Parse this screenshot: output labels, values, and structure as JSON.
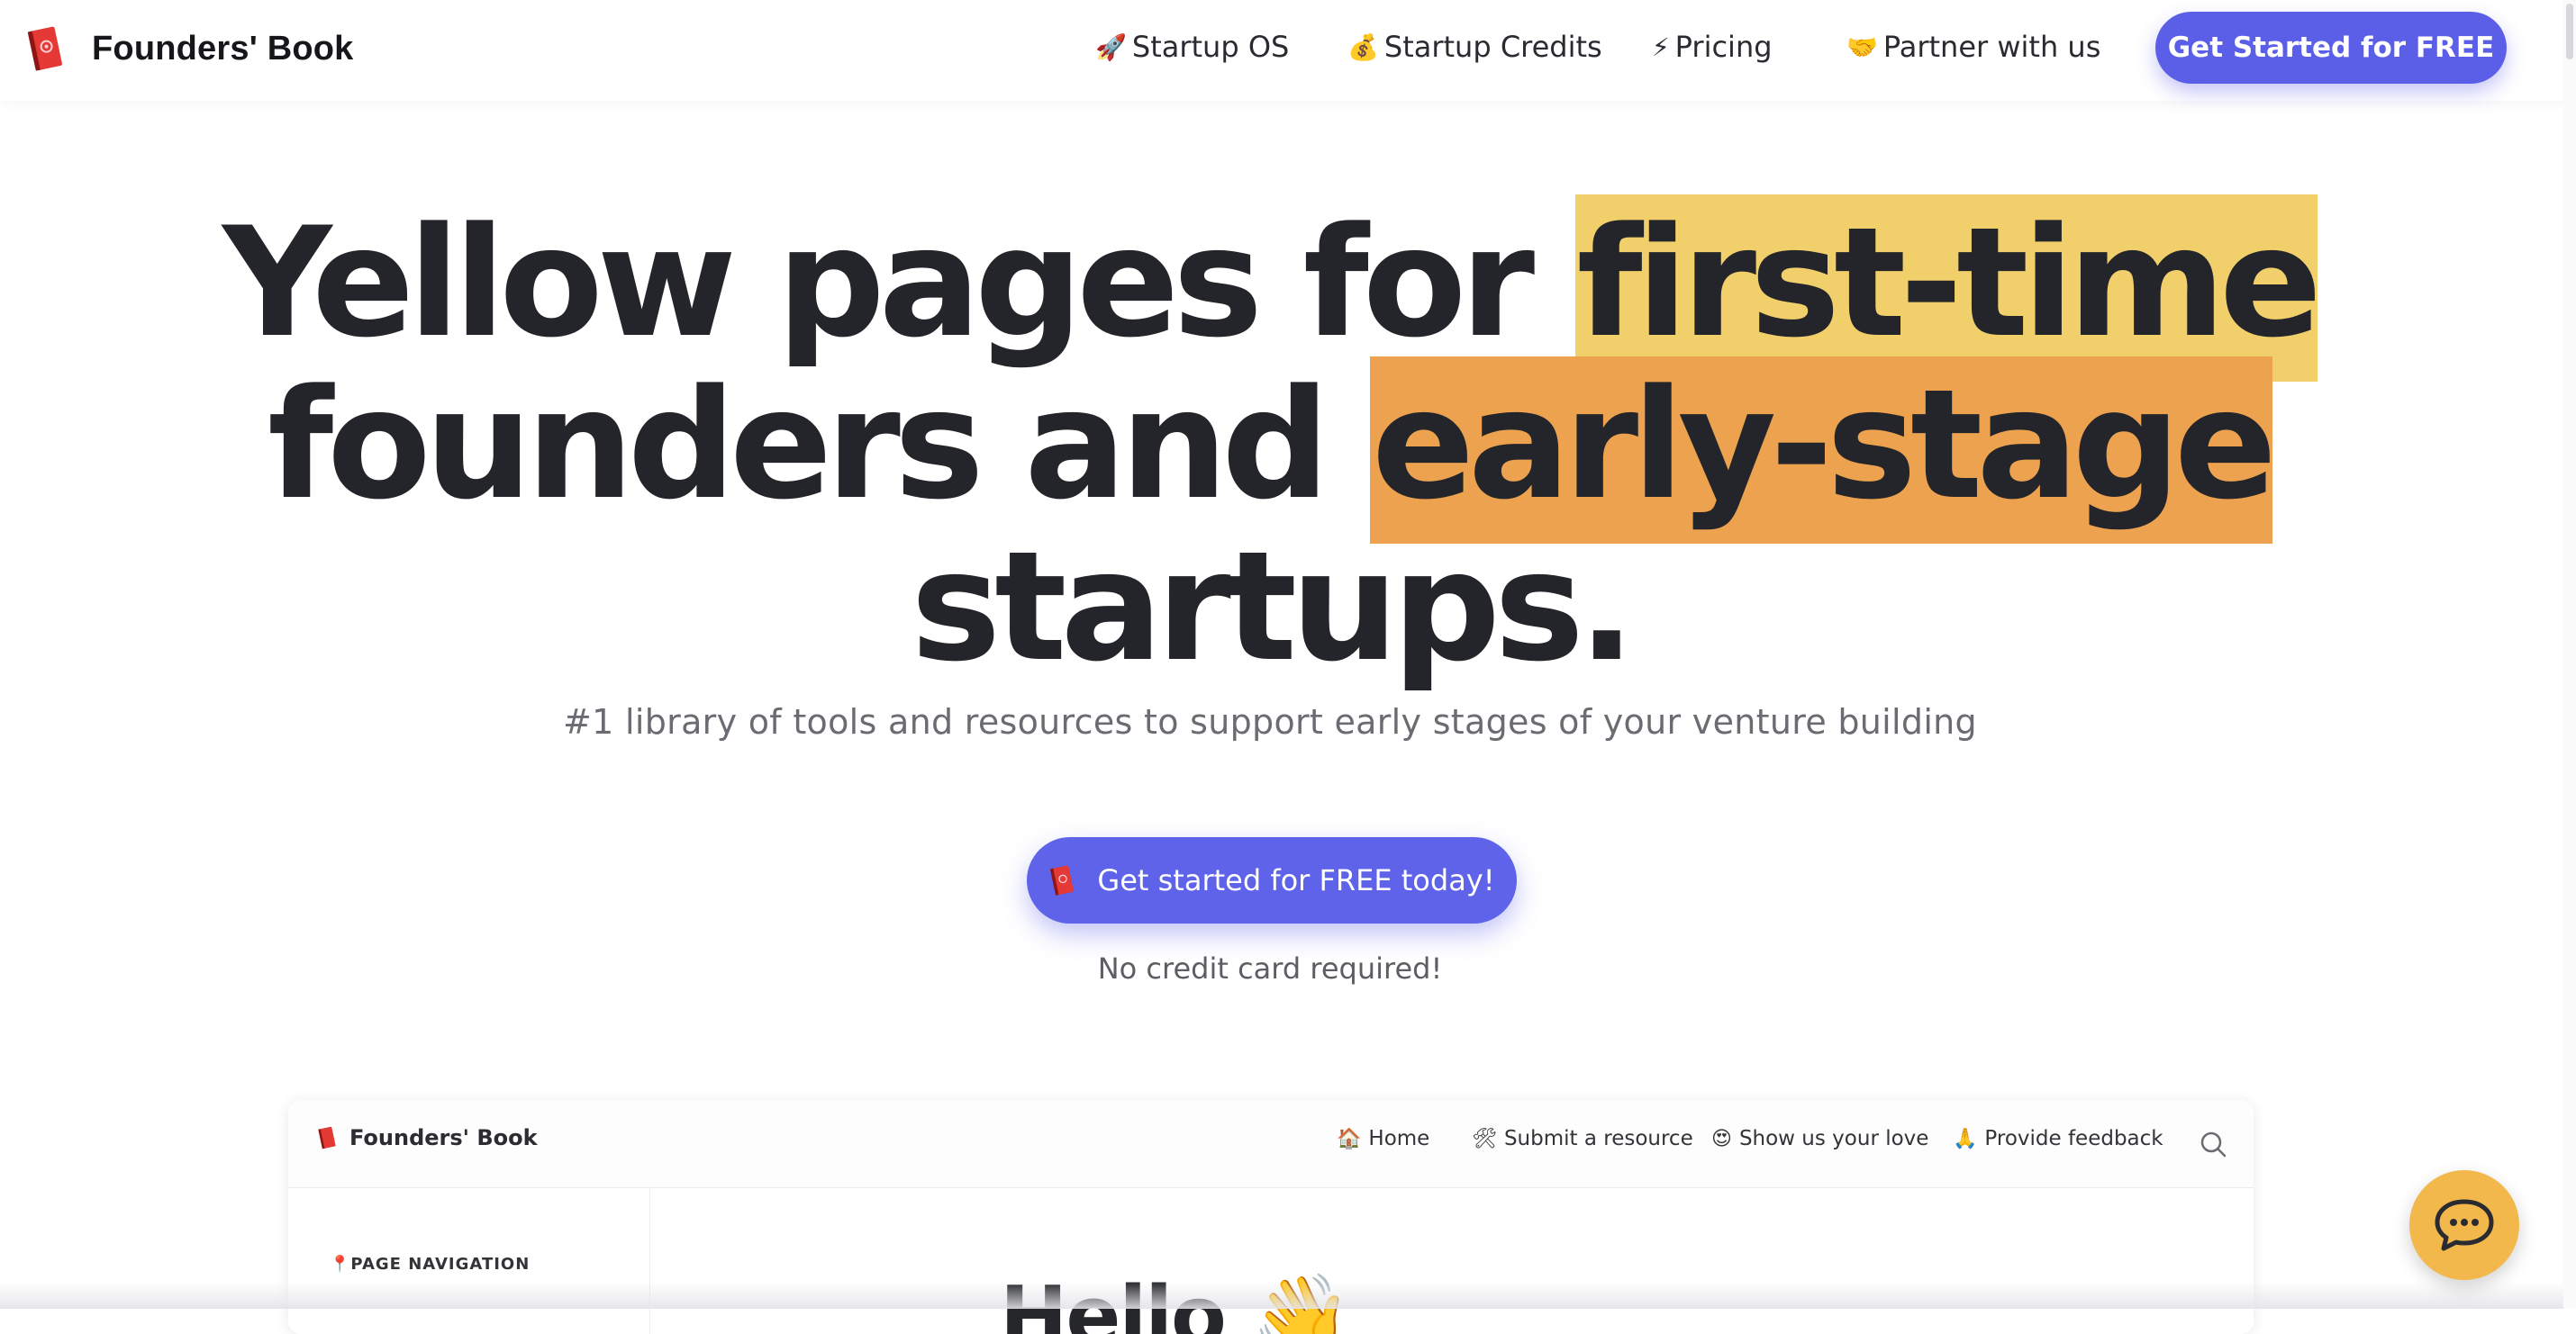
{
  "nav": {
    "brand": "Founders' Book",
    "links": [
      {
        "emoji": "🚀",
        "label": "Startup OS"
      },
      {
        "emoji": "💰",
        "label": "Startup Credits"
      },
      {
        "emoji": "⚡",
        "label": "Pricing"
      },
      {
        "emoji": "🤝",
        "label": "Partner with us"
      }
    ],
    "cta_label": "Get Started for FREE"
  },
  "hero": {
    "line1_plain": "Yellow pages for ",
    "line1_highlight": "first-time",
    "line2_plain": "founders and ",
    "line2_highlight": "early-stage",
    "line3": "startups.",
    "subtitle": "#1 library of tools and resources to support early stages of your venture building",
    "cta_label": "Get started for FREE today!",
    "cta_note": "No credit card required!"
  },
  "preview": {
    "brand": "Founders' Book",
    "links": [
      {
        "emoji": "🏠",
        "label": "Home"
      },
      {
        "emoji": "🛠",
        "label": "Submit a resource"
      },
      {
        "emoji": "😍",
        "label": "Show us your love"
      },
      {
        "emoji": "🙏",
        "label": "Provide feedback"
      }
    ],
    "sidebar_title_emoji": "📍",
    "sidebar_title": "PAGE NAVIGATION",
    "heading": "Hello",
    "heading_emoji": "👋"
  },
  "colors": {
    "accent": "#5b5fe8",
    "highlight_yellow": "#f1cf6a",
    "highlight_orange": "#eca24e",
    "chat_button": "#f2b84c",
    "text_dark": "#24252a"
  },
  "icons": {
    "brand": "red-book-icon",
    "search": "search-icon",
    "chat": "chat-bubble-icon"
  }
}
